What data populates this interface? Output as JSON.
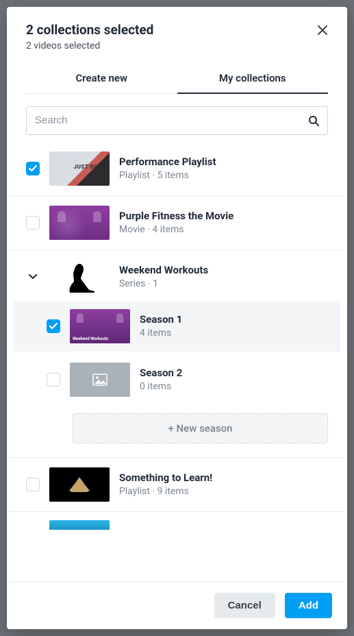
{
  "header": {
    "title": "2 collections selected",
    "subtitle": "2 videos selected"
  },
  "tabs": {
    "create": "Create new",
    "mine": "My collections"
  },
  "search": {
    "placeholder": "Search"
  },
  "items": [
    {
      "name": "Performance Playlist",
      "sub": "Playlist · 5 items",
      "checked": true
    },
    {
      "name": "Purple Fitness the Movie",
      "sub": "Movie · 4 items",
      "checked": false
    },
    {
      "name": "Weekend Workouts",
      "sub": "Series · 1",
      "expandable": true
    },
    {
      "name": "Something to Learn!",
      "sub": "Playlist · 9 items",
      "checked": false
    }
  ],
  "seasons": [
    {
      "name": "Season 1",
      "sub": "4 items",
      "checked": true
    },
    {
      "name": "Season 2",
      "sub": "0 items",
      "checked": false
    }
  ],
  "newSeason": "+ New season",
  "footer": {
    "cancel": "Cancel",
    "add": "Add"
  }
}
